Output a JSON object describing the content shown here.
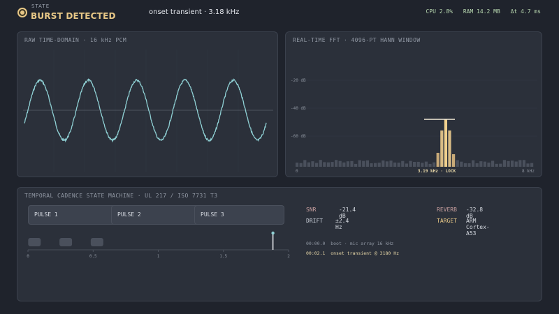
{
  "header": {
    "state_label": "STATE",
    "state_value": "BURST DETECTED",
    "event": "onset transient · 3.18 kHz",
    "cpu": "CPU 2.8%",
    "ram": "RAM 14.2 MB",
    "dt": "Δt 4.7 ms"
  },
  "colors": {
    "accent": "#e8c887",
    "wave": "#8fd0d4",
    "background": "#1f232c",
    "panel": "#2b303a"
  },
  "raw_panel": {
    "title": "RAW TIME-DOMAIN · 16 kHz PCM",
    "cycles": 5
  },
  "fft_panel": {
    "title": "REAL-TIME FFT · 4096-PT HANN WINDOW",
    "y_ticks": [
      "-20 dB",
      "-40 dB",
      "-60 dB"
    ],
    "x_left": "0",
    "x_right": "8 kHz",
    "lock_label": "3.19 kHz · LOCK"
  },
  "fsm_panel": {
    "title": "TEMPORAL CADENCE STATE MACHINE · UL 217 / ISO 7731 T3",
    "pulses": [
      "PULSE 1",
      "PULSE 2",
      "PULSE 3"
    ],
    "timeline": {
      "ticks": [
        "0",
        "0.5",
        "1",
        "1.5",
        "2"
      ],
      "markers": [
        0.05,
        0.29,
        0.53
      ],
      "cursor": 1.88
    },
    "metrics": {
      "snr_label": "SNR",
      "snr_value": "-21.4 dB",
      "drift_label": "DRIFT",
      "drift_value": "±2.4 Hz",
      "reverb_label": "REVERB",
      "reverb_value": "-32.8 dB",
      "target_label": "TARGET",
      "target_value": "ARM Cortex-A53"
    },
    "log": [
      {
        "time": "00:00.0",
        "text": "boot · mic array 16 kHz"
      },
      {
        "time": "00:02.1",
        "text": "onset transient @ 3180 Hz"
      }
    ]
  }
}
